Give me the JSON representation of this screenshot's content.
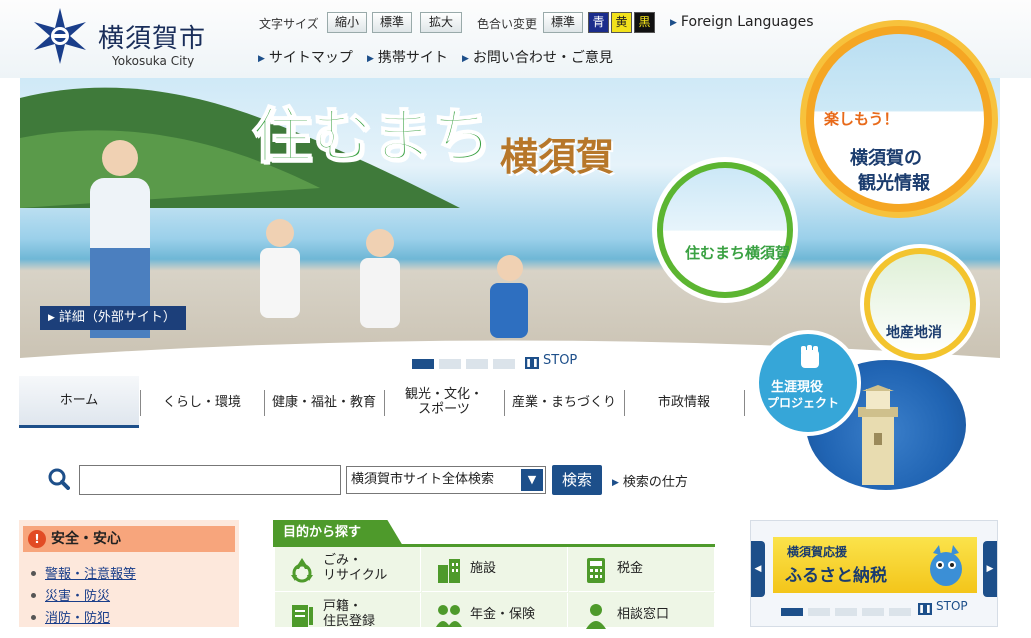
{
  "header": {
    "city_name": "横須賀市",
    "city_name_en": "Yokosuka City",
    "font_size_label": "文字サイズ",
    "font_sizes": [
      "縮小",
      "標準",
      "拡大"
    ],
    "color_label": "色合い変更",
    "colors": [
      {
        "label": "標準",
        "bg": "#e9eef0",
        "fg": "#222222"
      },
      {
        "label": "青",
        "bg": "#1a2c8c",
        "fg": "#ffffff"
      },
      {
        "label": "黄",
        "bg": "#f2e21b",
        "fg": "#222222"
      },
      {
        "label": "黒",
        "bg": "#111111",
        "fg": "#f2e21b"
      }
    ],
    "foreign_languages": "Foreign Languages",
    "links": [
      "サイトマップ",
      "携帯サイト",
      "お問い合わせ・ご意見"
    ]
  },
  "hero": {
    "title": "住むまち",
    "title_sub": "横須賀",
    "detail_link": "詳細（外部サイト）",
    "slide_count": 4,
    "active_slide": 1,
    "stop_label": "STOP"
  },
  "banners": {
    "tourism_title": "楽しもう！",
    "tourism_line1": "横須賀の",
    "tourism_line2": "観光情報",
    "sumu_text": "住むまち横須賀",
    "local_text": "地産地消",
    "lifelong_line1": "生涯現役",
    "lifelong_line2": "プロジェクト"
  },
  "nav": {
    "items": [
      "ホーム",
      "くらし・環境",
      "健康・福祉・教育",
      "観光・文化・\nスポーツ",
      "産業・まちづくり",
      "市政情報"
    ],
    "active": 0
  },
  "search": {
    "placeholder": "",
    "scope": "横須賀市サイト全体検索",
    "button": "検索",
    "help": "検索の仕方"
  },
  "safety": {
    "heading": "安全・安心",
    "links": [
      "警報・注意報等",
      "災害・防災",
      "消防・防犯"
    ]
  },
  "purpose": {
    "heading": "目的から探す",
    "items": [
      "ごみ・\nリサイクル",
      "施設",
      "税金",
      "戸籍・\n住民登録",
      "年金・保険",
      "相談窓口"
    ]
  },
  "furusato": {
    "line1": "横須賀応援",
    "line2": "ふるさと納税",
    "slide_count": 5,
    "active_slide": 1,
    "stop_label": "STOP"
  },
  "colors": {
    "brand_navy": "#1d4f8a",
    "green": "#4e9a2b",
    "safety_bg": "#fde8dc",
    "safety_head": "#f7a57c"
  }
}
